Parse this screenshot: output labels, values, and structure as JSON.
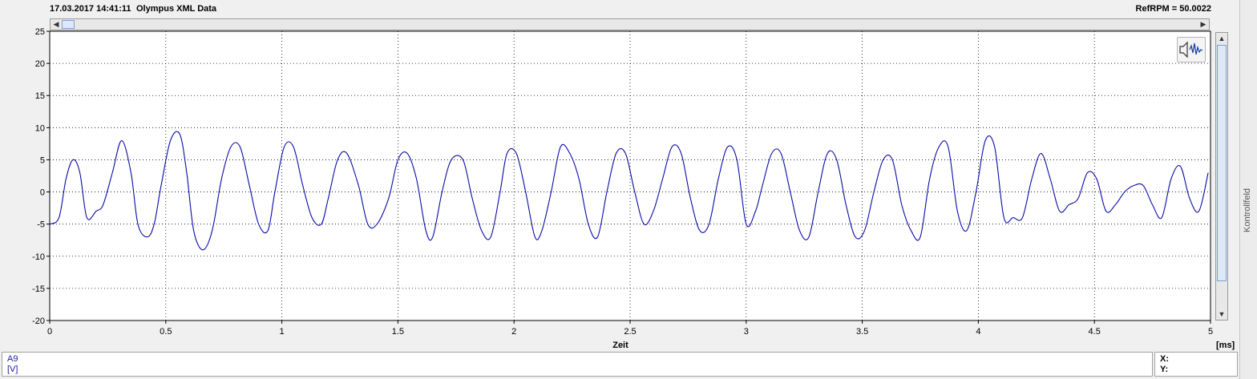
{
  "header": {
    "timestamp": "17.03.2017 14:41:11",
    "title": "Olympus XML Data",
    "ref_rpm": "RefRPM = 50.0022"
  },
  "side_panel": {
    "label": "Kontrollfeld"
  },
  "legend": {
    "channel": "A9",
    "unit": "[V]"
  },
  "readout": {
    "x_label": "X:",
    "y_label": "Y:"
  },
  "icons": {
    "audio": "speaker-waveform-icon"
  },
  "colors": {
    "trace": "#0a0aa8",
    "grid": "#000000",
    "background": "#ffffff"
  },
  "chart_data": {
    "type": "line",
    "title": "",
    "xlabel": "Zeit",
    "x_unit": "[ms]",
    "ylabel": "",
    "xlim": [
      0,
      5
    ],
    "ylim": [
      -20,
      25
    ],
    "grid": true,
    "x_ticks": [
      "0",
      "0.5",
      "1",
      "1.5",
      "2",
      "2.5",
      "3",
      "3.5",
      "4",
      "4.5",
      "5"
    ],
    "y_ticks": [
      "25",
      "20",
      "15",
      "10",
      "5",
      "0",
      "-5",
      "-10",
      "-15",
      "-20"
    ],
    "series": [
      {
        "x": [
          0,
          0.04,
          0.07,
          0.1,
          0.13,
          0.16,
          0.2,
          0.23,
          0.27,
          0.31,
          0.35,
          0.38,
          0.42,
          0.45,
          0.48,
          0.52,
          0.56,
          0.59,
          0.62,
          0.66,
          0.7,
          0.74,
          0.78,
          0.82,
          0.86,
          0.9,
          0.94,
          0.97,
          1.01,
          1.05,
          1.09,
          1.13,
          1.17,
          1.2,
          1.24,
          1.28,
          1.33,
          1.37,
          1.41,
          1.46,
          1.5,
          1.54,
          1.58,
          1.62,
          1.65,
          1.69,
          1.73,
          1.78,
          1.82,
          1.86,
          1.9,
          1.94,
          1.97,
          2.01,
          2.05,
          2.09,
          2.12,
          2.16,
          2.2,
          2.24,
          2.28,
          2.32,
          2.36,
          2.4,
          2.44,
          2.48,
          2.52,
          2.56,
          2.6,
          2.64,
          2.68,
          2.72,
          2.76,
          2.8,
          2.84,
          2.88,
          2.92,
          2.96,
          3.0,
          3.04,
          3.07,
          3.11,
          3.15,
          3.19,
          3.23,
          3.27,
          3.31,
          3.35,
          3.39,
          3.43,
          3.47,
          3.51,
          3.55,
          3.59,
          3.63,
          3.67,
          3.71,
          3.75,
          3.79,
          3.83,
          3.87,
          3.91,
          3.95,
          3.99,
          4.03,
          4.07,
          4.11,
          4.15,
          4.19,
          4.23,
          4.27,
          4.31,
          4.35,
          4.39,
          4.43,
          4.47,
          4.51,
          4.55,
          4.59,
          4.63,
          4.67,
          4.71,
          4.75,
          4.79,
          4.83,
          4.87,
          4.91,
          4.95,
          4.99
        ],
        "values": [
          -5,
          -4,
          2,
          5,
          3,
          -4,
          -3,
          -2,
          3,
          8,
          3,
          -5,
          -7,
          -5,
          1,
          8,
          9,
          3,
          -6,
          -9,
          -6,
          2,
          7,
          7,
          1,
          -5,
          -6,
          0,
          7,
          7,
          1,
          -4,
          -5,
          -1,
          5,
          6,
          1,
          -5,
          -5,
          -1,
          5,
          6,
          2,
          -6,
          -7,
          0,
          5,
          5,
          -1,
          -6,
          -7,
          0,
          6,
          6,
          0,
          -7,
          -6,
          0,
          7,
          6,
          2,
          -5,
          -7,
          0,
          6,
          6,
          0,
          -5,
          -3,
          2,
          7,
          6,
          -1,
          -6,
          -5,
          2,
          7,
          5,
          -5,
          -3,
          1,
          6,
          6,
          0,
          -6,
          -7,
          0,
          6,
          5,
          -2,
          -7,
          -6,
          0,
          5,
          5,
          -2,
          -6,
          -7,
          2,
          7,
          7,
          -3,
          -6,
          0,
          8,
          7,
          -4,
          -4,
          -4,
          2,
          6,
          2,
          -3,
          -2,
          -1,
          3,
          2,
          -3,
          -2,
          0,
          1,
          1,
          -2,
          -4,
          2,
          4,
          -1,
          -3,
          3
        ]
      }
    ]
  }
}
